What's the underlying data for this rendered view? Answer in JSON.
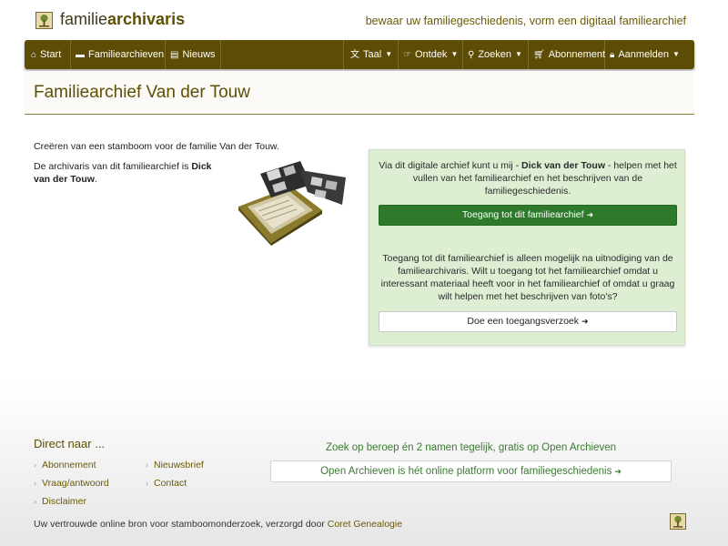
{
  "header": {
    "brand_light": "familie",
    "brand_bold": "archivaris",
    "tagline": "bewaar uw familiegeschiedenis, vorm een digitaal familiearchief"
  },
  "nav": {
    "start": "Start",
    "familiearchieven": "Familiearchieven",
    "nieuws": "Nieuws",
    "taal": "Taal",
    "ontdek": "Ontdek",
    "zoeken": "Zoeken",
    "abonnement": "Abonnement",
    "aanmelden": "Aanmelden"
  },
  "page": {
    "title": "Familiearchief Van der Touw",
    "intro1": "Creëren van een stamboom voor de familie Van der Touw.",
    "intro2_prefix": "De archivaris van dit familiearchief is ",
    "intro2_name": "Dick van der Touw",
    "intro2_suffix": "."
  },
  "panel": {
    "p1_prefix": "Via dit digitale archief kunt u mij - ",
    "p1_name": "Dick van der Touw",
    "p1_suffix": " - helpen met het vullen van het familiearchief en het beschrijven van de familiegeschiedenis.",
    "access_button": "Toegang tot dit familiearchief",
    "p2": "Toegang tot dit familiearchief is alleen mogelijk na uitnodiging van de familiearchivaris. Wilt u toegang tot het familiearchief omdat u interessant materiaal heeft voor in het familiearchief of omdat u graag wilt helpen met het beschrijven van foto's?",
    "request_button": "Doe een toegangsverzoek"
  },
  "footer": {
    "title": "Direct naar ...",
    "links": {
      "abonnement": "Abonnement",
      "nieuwsbrief": "Nieuwsbrief",
      "vraag": "Vraag/antwoord",
      "contact": "Contact",
      "disclaimer": "Disclaimer"
    },
    "promo": "Zoek op beroep én 2 namen tegelijk, gratis op Open Archieven",
    "promo_box": "Open Archieven is hét online platform voor familiegeschiedenis",
    "note_prefix": "Uw vertrouwde online bron voor stamboomonderzoek, verzorgd door ",
    "note_link": "Coret Genealogie"
  },
  "icons": {
    "home": "home-icon",
    "book": "book-icon",
    "newspaper": "newspaper-icon",
    "language": "language-icon",
    "hand": "hand-pointer-icon",
    "search": "search-icon",
    "cart": "cart-icon",
    "lock": "lock-icon",
    "chevron": "chevron-down-icon",
    "arrow_circle": "arrow-circle-right-icon"
  },
  "colors": {
    "nav_bg": "#5c4c05",
    "title_color": "#5d4f04",
    "panel_bg": "#ddeed2",
    "button_green": "#2e7a2a",
    "link_green": "#3c7a32"
  }
}
